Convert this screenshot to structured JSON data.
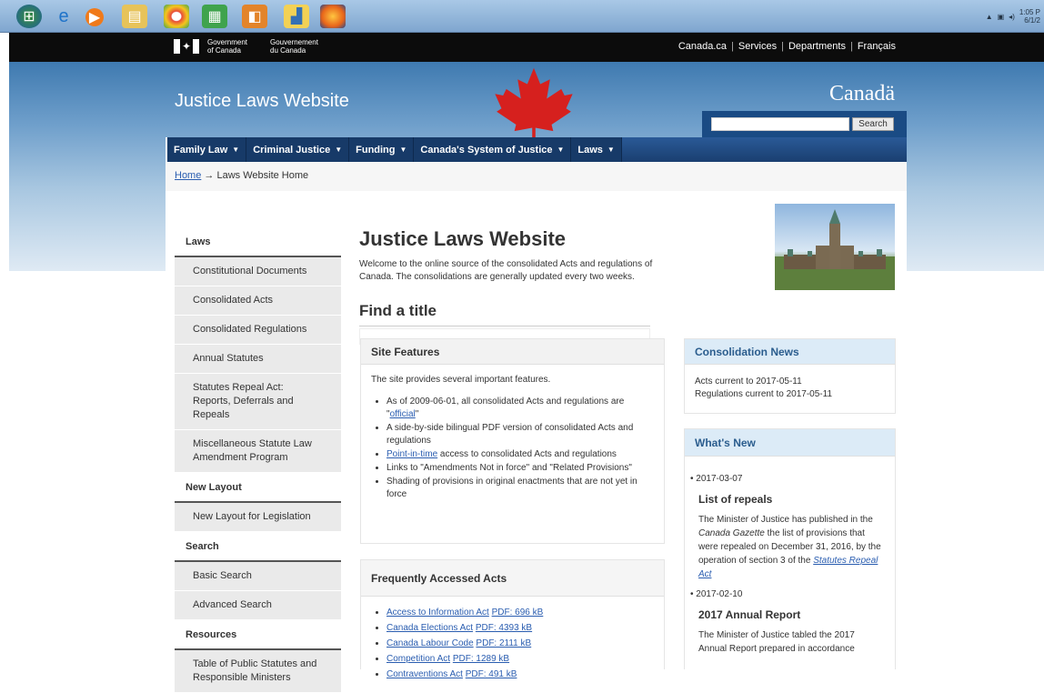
{
  "os": {
    "tray_time": "1:05 P",
    "tray_date": "6/1/2"
  },
  "signature": {
    "gov_en_1": "Government",
    "gov_en_2": "of Canada",
    "gov_fr_1": "Gouvernement",
    "gov_fr_2": "du Canada",
    "links": [
      "Canada.ca",
      "Services",
      "Departments",
      "Français"
    ]
  },
  "banner": {
    "site_title": "Justice Laws Website",
    "wordmark": "Canadä",
    "search_button": "Search"
  },
  "menu": [
    {
      "label": "Family Law"
    },
    {
      "label": "Criminal Justice"
    },
    {
      "label": "Funding"
    },
    {
      "label": "Canada's System of Justice"
    },
    {
      "label": "Laws"
    }
  ],
  "breadcrumb": {
    "home": "Home",
    "arrow": "→",
    "current": "Laws Website Home"
  },
  "sidebar": {
    "sections": [
      {
        "title": "Laws",
        "items": [
          "Constitutional Documents",
          "Consolidated Acts",
          "Consolidated Regulations",
          "Annual Statutes",
          "Statutes Repeal Act: Reports, Deferrals and Repeals",
          "Miscellaneous Statute Law Amendment Program"
        ]
      },
      {
        "title": "New Layout",
        "items": [
          "New Layout for Legislation"
        ]
      },
      {
        "title": "Search",
        "items": [
          "Basic Search",
          "Advanced Search"
        ]
      },
      {
        "title": "Resources",
        "items": [
          "Table of Public Statutes and Responsible Ministers"
        ]
      }
    ]
  },
  "main": {
    "title": "Justice Laws Website",
    "intro": "Welcome to the online source of the consolidated Acts and regulations of Canada. The consolidations are generally updated every two weeks.",
    "find_title": "Find a title"
  },
  "site_features": {
    "heading": "Site Features",
    "lead": "The site provides several important features.",
    "bullet1_pre": "As of 2009-06-01, all consolidated Acts and regulations are \"",
    "bullet1_link": "official",
    "bullet1_post": "\"",
    "bullet2": "A side-by-side bilingual PDF version of consolidated Acts and regulations",
    "bullet3_link": "Point-in-time",
    "bullet3_post": " access to consolidated Acts and regulations",
    "bullet4": "Links to \"Amendments Not in force\" and \"Related Provisions\"",
    "bullet5": "Shading of provisions in original enactments that are not yet in force"
  },
  "frequent": {
    "heading": "Frequently Accessed Acts",
    "items": [
      {
        "name": "Access to Information Act",
        "pdf": "PDF: 696 kB"
      },
      {
        "name": "Canada Elections Act",
        "pdf": "PDF: 4393 kB"
      },
      {
        "name": "Canada Labour Code",
        "pdf": "PDF: 2111 kB"
      },
      {
        "name": "Competition Act",
        "pdf": "PDF: 1289 kB"
      },
      {
        "name": "Contraventions Act",
        "pdf": "PDF: 491 kB"
      }
    ]
  },
  "consolidation": {
    "heading": "Consolidation News",
    "line1": "Acts current to 2017-05-11",
    "line2": "Regulations current to 2017-05-11"
  },
  "whats_new": {
    "heading": "What's New",
    "item1_date": "2017-03-07",
    "item1_title": "List of repeals",
    "item1_text_a": "The Minister of Justice has published in the ",
    "item1_text_italic": "Canada Gazette",
    "item1_text_b": " the list of provisions that were repealed on December 31, 2016, by the operation of section 3 of the ",
    "item1_link": "Statutes Repeal Act",
    "item2_date": "2017-02-10",
    "item2_title": "2017 Annual Report",
    "item2_text": "The Minister of Justice tabled the 2017 Annual Report prepared in accordance"
  }
}
